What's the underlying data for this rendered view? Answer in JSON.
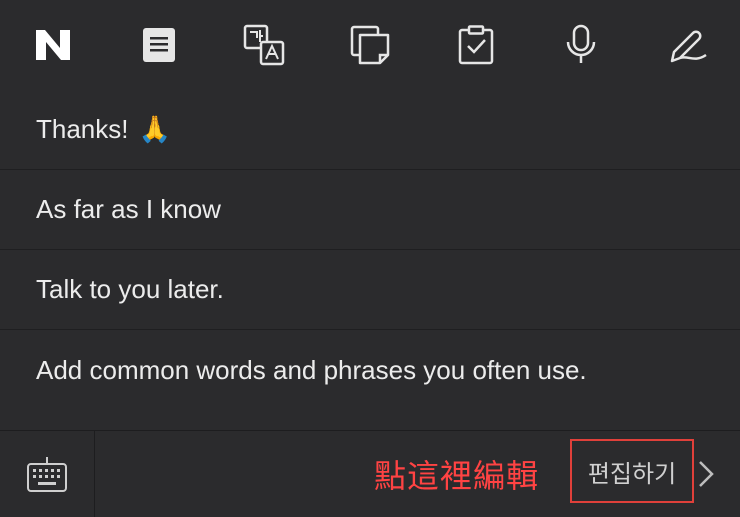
{
  "toolbar": {
    "icons": [
      "naver-logo-icon",
      "note-icon",
      "translate-icon",
      "copy-icon",
      "clipboard-check-icon",
      "microphone-icon",
      "handwriting-pen-icon"
    ]
  },
  "phrases": {
    "items": [
      {
        "text": "Thanks!",
        "emoji": "🙏"
      },
      {
        "text": "As far as I know"
      },
      {
        "text": "Talk to you later."
      },
      {
        "text": "Add common words and phrases you often use."
      }
    ]
  },
  "bottom": {
    "annotation": "點這裡編輯",
    "edit_label": "편집하기"
  },
  "colors": {
    "background": "#2b2b2d",
    "text": "#ececec",
    "annotation": "#ff4343",
    "highlight_border": "#e0403a"
  }
}
